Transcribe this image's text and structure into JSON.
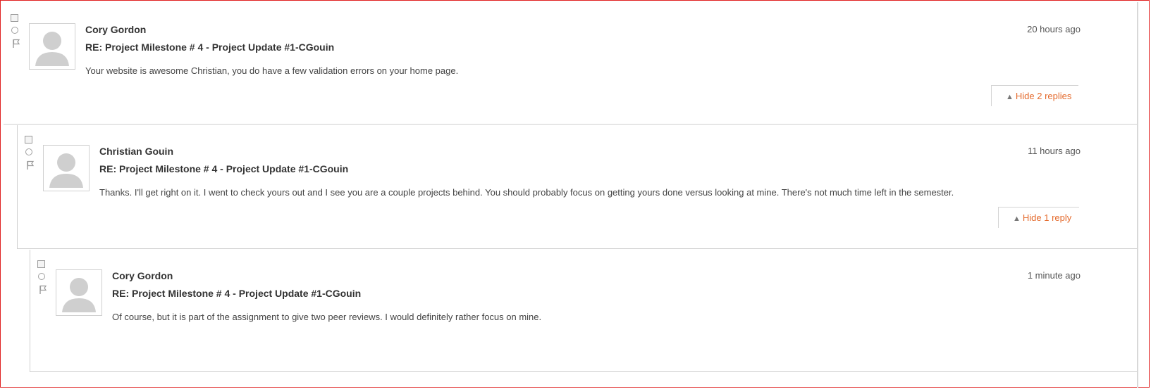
{
  "thread": {
    "posts": [
      {
        "author": "Cory Gordon",
        "subject": "RE: Project Milestone # 4 - Project Update #1-CGouin",
        "body": "Your website is awesome Christian, you do have a few validation errors on your home page.",
        "time": "20 hours ago",
        "toggle_label": "Hide 2 replies"
      },
      {
        "author": "Christian Gouin",
        "subject": "RE: Project Milestone # 4 - Project Update #1-CGouin",
        "body": "Thanks. I'll get right on it. I went to check yours out and I see you are a couple projects behind. You should probably focus on getting yours done versus looking at mine. There's not much time left in the semester.",
        "time": "11 hours ago",
        "toggle_label": "Hide 1 reply"
      },
      {
        "author": "Cory Gordon",
        "subject": "RE: Project Milestone # 4 - Project Update #1-CGouin",
        "body": "Of course, but it is part of the assignment to give two peer reviews. I would definitely rather focus on mine.",
        "time": "1 minute ago"
      }
    ]
  },
  "icons": {
    "toggle_arrow": "triangle-up-icon",
    "flag": "flag-icon",
    "avatar": "default-user-avatar"
  },
  "colors": {
    "accent": "#e46a2c",
    "frame_border": "#e02020"
  }
}
